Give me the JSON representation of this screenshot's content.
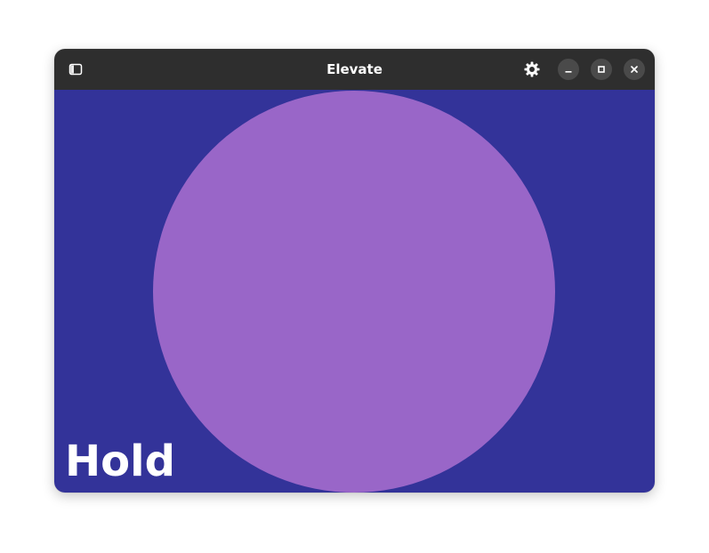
{
  "window": {
    "title": "Elevate"
  },
  "headerbar": {
    "sidebar_toggle_icon": "sidebar-icon",
    "settings_icon": "gear-icon",
    "minimize_icon": "minimize-icon",
    "maximize_icon": "maximize-icon",
    "close_icon": "close-icon"
  },
  "content": {
    "background_color": "#333399",
    "circle_color": "#9966c8",
    "label": "Hold"
  }
}
